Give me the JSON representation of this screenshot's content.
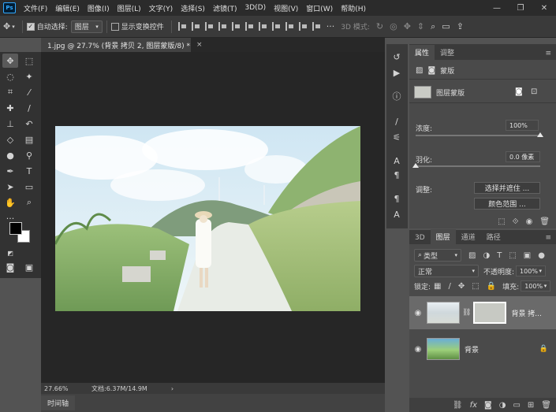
{
  "app": {
    "logo": "Ps"
  },
  "menu": [
    "文件(F)",
    "编辑(E)",
    "图像(I)",
    "图层(L)",
    "文字(Y)",
    "选择(S)",
    "滤镜(T)",
    "3D(D)",
    "视图(V)",
    "窗口(W)",
    "帮助(H)"
  ],
  "window_controls": {
    "minimize": "—",
    "restore": "❐",
    "close": "✕"
  },
  "options": {
    "auto_select_label": "自动选择:",
    "auto_select_value": "图层",
    "show_transform_label": "显示变换控件",
    "mode_3d_label": "3D 模式:"
  },
  "document": {
    "tab_title": "1.jpg @ 27.7% (背景 拷贝 2, 图层蒙版/8) *",
    "close": "×",
    "zoom": "27.66%",
    "doc_size": "文档:6.37M/14.9M",
    "status_arrow": "›"
  },
  "timeline": {
    "label": "时间轴"
  },
  "properties": {
    "tabs": [
      "属性",
      "调整"
    ],
    "mask_type_label": "蒙版",
    "layer_mask_label": "图层蒙版",
    "density_label": "浓度:",
    "density_value": "100%",
    "density_fraction": 1.0,
    "feather_label": "羽化:",
    "feather_value": "0.0 像素",
    "feather_fraction": 0.0,
    "adjust_label": "调整:",
    "select_and_mask_btn": "选择并遮住 ...",
    "color_range_btn": "颜色范围 ..."
  },
  "layers": {
    "tabs": [
      "3D",
      "图层",
      "通道",
      "路径"
    ],
    "filter_type": "类型",
    "blend_mode": "正常",
    "opacity_label": "不透明度:",
    "opacity_value": "100%",
    "lock_label": "锁定:",
    "fill_label": "填充:",
    "fill_value": "100%",
    "items": [
      {
        "name": "背景 拷...",
        "selected": true
      },
      {
        "name": "背景",
        "selected": false
      }
    ]
  },
  "colors": {
    "accent": "#31a8ff",
    "foreground": "#000000",
    "background": "#ffffff"
  }
}
